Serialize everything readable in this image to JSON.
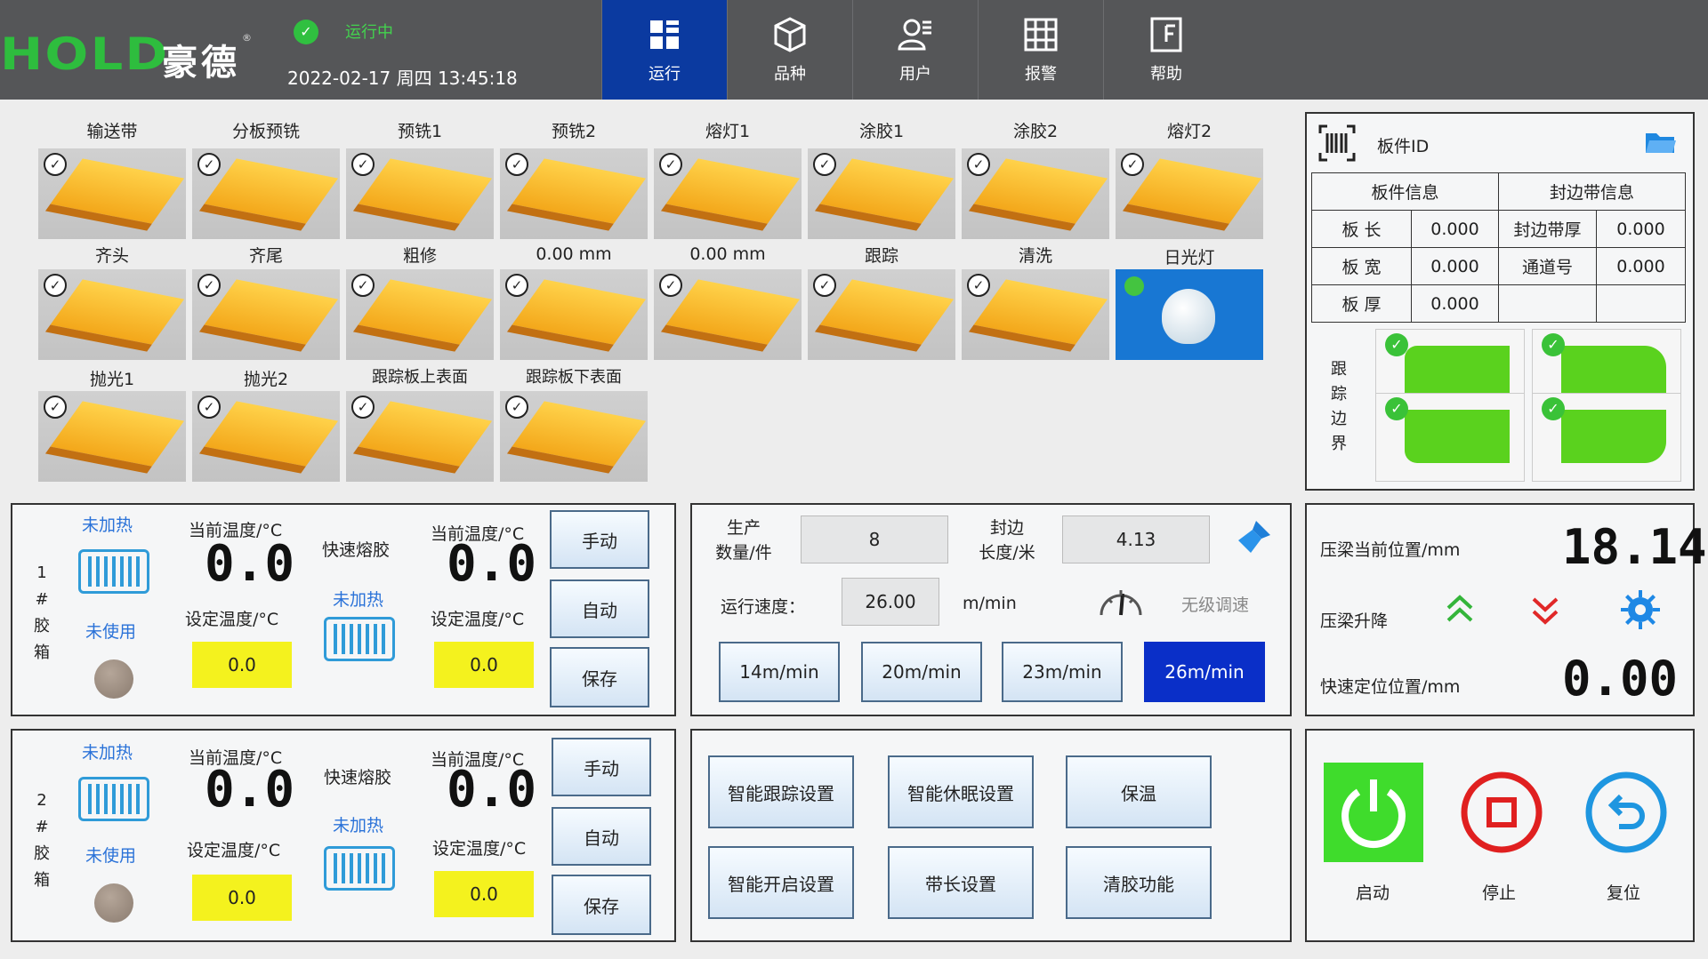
{
  "header": {
    "logo_text": "HOLD",
    "logo_cn": "豪德",
    "logo_reg": "®",
    "status_label": "运行中",
    "datetime": "2022-02-17 周四 13:45:18",
    "nav": [
      {
        "label": "运行",
        "icon": "dashboard-icon",
        "active": true
      },
      {
        "label": "品种",
        "icon": "cube-icon",
        "active": false
      },
      {
        "label": "用户",
        "icon": "user-icon",
        "active": false
      },
      {
        "label": "报警",
        "icon": "grid-icon",
        "active": false
      },
      {
        "label": "帮助",
        "icon": "help-panel-icon",
        "active": false
      }
    ]
  },
  "stations": {
    "row1": [
      "输送带",
      "分板预铣",
      "预铣1",
      "预铣2",
      "熔灯1",
      "涂胶1",
      "涂胶2",
      "熔灯2"
    ],
    "row2": [
      "齐头",
      "齐尾",
      "粗修",
      "0.00   mm",
      "0.00   mm",
      "跟踪",
      "清洗",
      "日光灯"
    ],
    "row3": [
      "抛光1",
      "抛光2",
      "跟踪板上表面",
      "跟踪板下表面"
    ]
  },
  "board_info": {
    "title": "板件ID",
    "header_left": "板件信息",
    "header_right": "封边带信息",
    "rows": [
      {
        "label": "板 长",
        "value": "0.000",
        "label2": "封边带厚",
        "value2": "0.000"
      },
      {
        "label": "板 宽",
        "value": "0.000",
        "label2": "通道号",
        "value2": "0.000"
      },
      {
        "label": "板 厚",
        "value": "0.000",
        "label2": "",
        "value2": ""
      }
    ],
    "side_label": "跟 踪 边 界",
    "shapes": [
      "top-left",
      "top-right",
      "bottom-left",
      "bottom-right"
    ]
  },
  "glue1": {
    "name": "1 # 胶 箱",
    "heat_label": "未加热",
    "use_label": "未使用",
    "cur_temp_label": "当前温度/°C",
    "cur_temp": "0.0",
    "set_temp_label": "设定温度/°C",
    "set_temp": "0.0",
    "fast_label": "快速熔胶",
    "fast_heat_label": "未加热",
    "cur_temp2_label": "当前温度/°C",
    "cur_temp2": "0.0",
    "set_temp2_label": "设定温度/°C",
    "set_temp2": "0.0",
    "btn_manual": "手动",
    "btn_auto": "自动",
    "btn_save": "保存"
  },
  "glue2": {
    "name": "2 # 胶 箱",
    "heat_label": "未加热",
    "use_label": "未使用",
    "cur_temp_label": "当前温度/°C",
    "cur_temp": "0.0",
    "set_temp_label": "设定温度/°C",
    "set_temp": "0.0",
    "fast_label": "快速熔胶",
    "fast_heat_label": "未加热",
    "cur_temp2_label": "当前温度/°C",
    "cur_temp2": "0.0",
    "set_temp2_label": "设定温度/°C",
    "set_temp2": "0.0",
    "btn_manual": "手动",
    "btn_auto": "自动",
    "btn_save": "保存"
  },
  "production": {
    "count_label": "生产\n数量/件",
    "count": "8",
    "edge_label": "封边\n长度/米",
    "edge_length": "4.13",
    "speed_label": "运行速度：",
    "speed": "26.00",
    "speed_unit": "m/min",
    "sensor_label": "无级调速",
    "speed_presets": [
      "14m/min",
      "20m/min",
      "23m/min",
      "26m/min"
    ],
    "active_preset": 3
  },
  "press": {
    "pos_label": "压梁当前位置/mm",
    "pos_value": "18.14",
    "lift_label": "压梁升降",
    "quick_label": "快速定位位置/mm",
    "quick_value": "0.00"
  },
  "functions": [
    "智能跟踪设置",
    "智能休眠设置",
    "保温",
    "智能开启设置",
    "带长设置",
    "清胶功能"
  ],
  "controls": {
    "start": "启动",
    "stop": "停止",
    "reset": "复位"
  }
}
